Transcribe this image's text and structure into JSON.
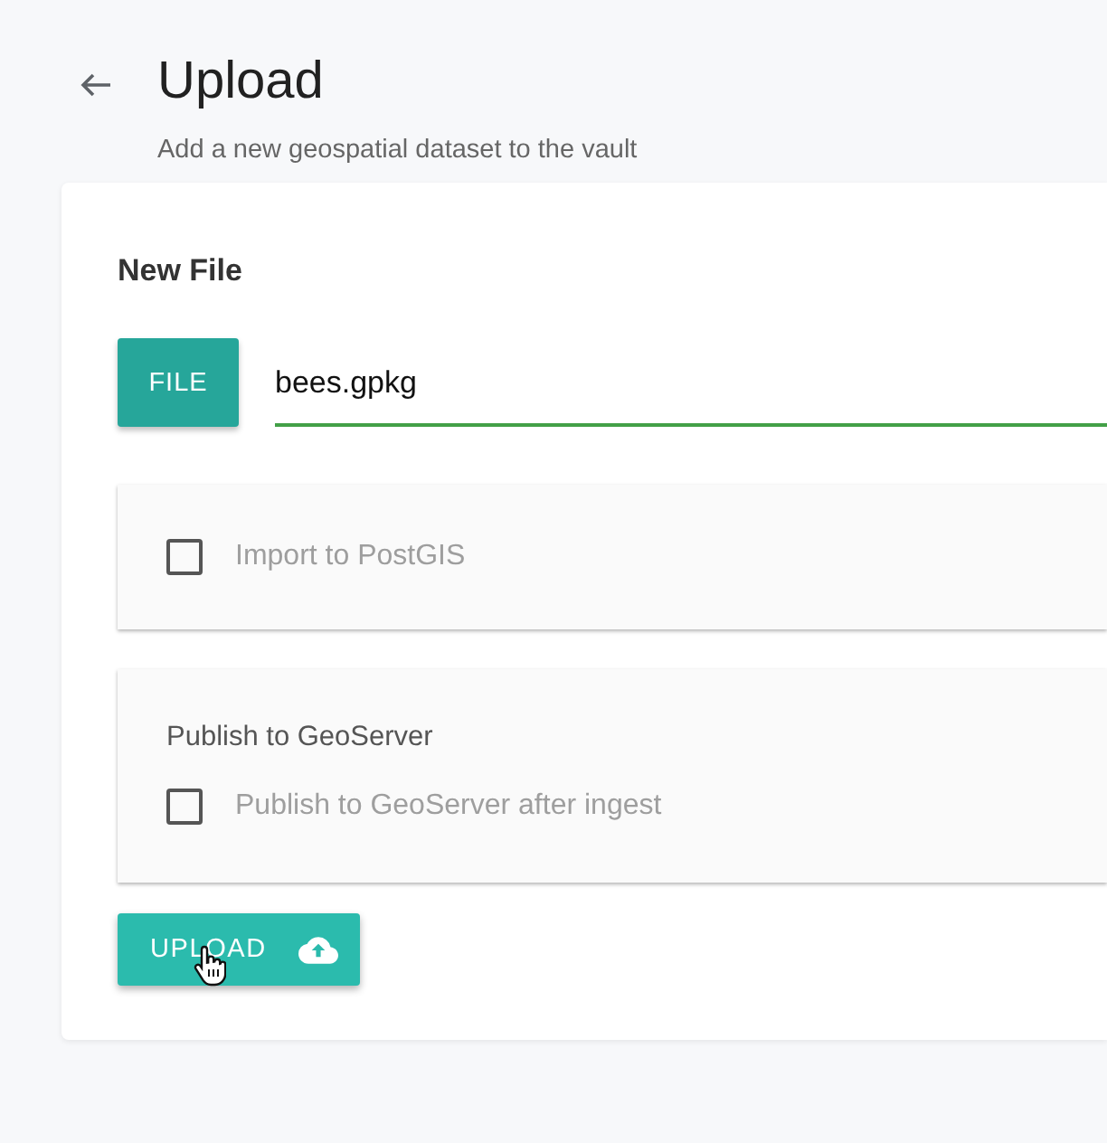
{
  "header": {
    "title": "Upload",
    "subtitle": "Add a new geospatial dataset to the vault"
  },
  "form": {
    "heading": "New File",
    "file_button": "FILE",
    "file_field": {
      "value": "bees.gpkg"
    }
  },
  "panels": [
    {
      "options": [
        {
          "label": "Import to PostGIS",
          "checked": false
        }
      ]
    },
    {
      "title": "Publish to GeoServer",
      "options": [
        {
          "label": "Publish to GeoServer after ingest",
          "checked": false
        }
      ]
    }
  ],
  "upload_button": {
    "label": "UPLOAD"
  }
}
